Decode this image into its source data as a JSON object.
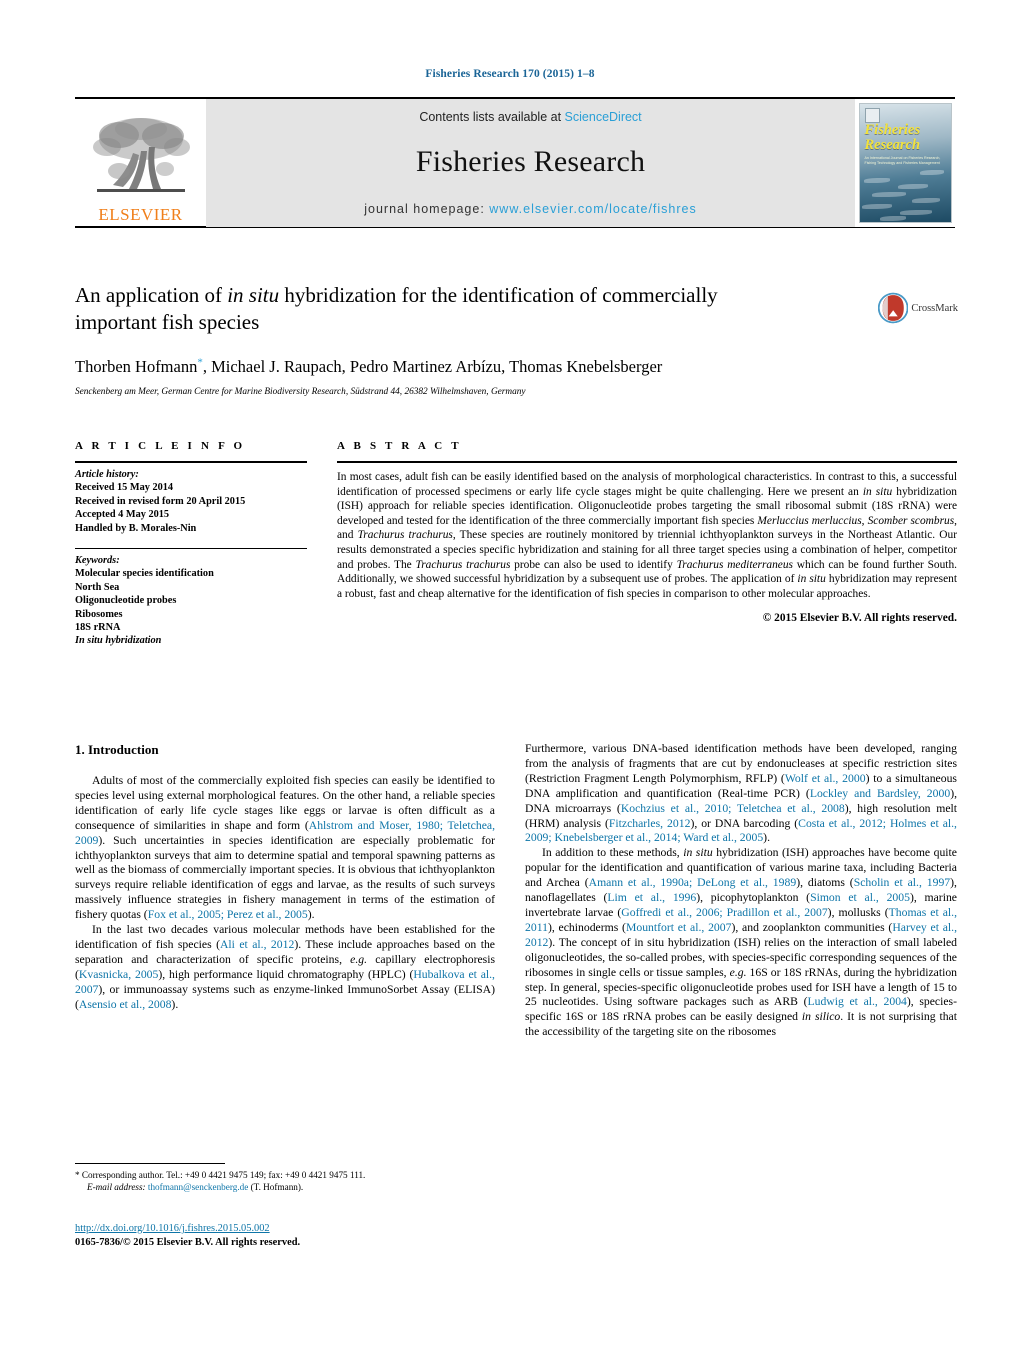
{
  "running_head": "Fisheries Research 170 (2015) 1–8",
  "masthead": {
    "publisher_logo_text": "ELSEVIER",
    "contents_prefix": "Contents lists available at",
    "contents_link": "ScienceDirect",
    "journal_name": "Fisheries Research",
    "homepage_prefix": "journal homepage:",
    "homepage_url": "www.elsevier.com/locate/fishres",
    "cover": {
      "title_line1": "Fisheries",
      "title_line2": "Research",
      "subtitle": "An International Journal on Fisheries Research, Fishing Technology and Fisheries Management"
    }
  },
  "article": {
    "title_part1": "An application of ",
    "title_italic": "in situ",
    "title_part2": " hybridization for the identification of commercially important fish species",
    "authors": "Thorben Hofmann, Michael J. Raupach, Pedro Martinez Arbízu, Thomas Knebelsberger",
    "author_marker": "*",
    "affiliation": "Senckenberg am Meer, German Centre for Marine Biodiversity Research, Südstrand 44, 26382 Wilhelmshaven, Germany",
    "crossmark_label": "CrossMark"
  },
  "article_info": {
    "heading": "A R T I C L E   I N F O",
    "history_label": "Article history:",
    "history": [
      "Received 15 May 2014",
      "Received in revised form 20 April 2015",
      "Accepted 4 May 2015",
      "Handled by B. Morales-Nin"
    ],
    "keywords_label": "Keywords:",
    "keywords": [
      "Molecular species identification",
      "North Sea",
      "Oligonucleotide probes",
      "Ribosomes",
      "18S rRNA"
    ],
    "keyword_italic": "In situ hybridization"
  },
  "abstract": {
    "heading": "A B S T R A C T",
    "paragraphs": [
      "In most cases, adult fish can be easily identified based on the analysis of morphological characteristics. In contrast to this, a successful identification of processed specimens or early life cycle stages might be quite challenging. Here we present an ",
      " hybridization (ISH) approach for reliable species identification. Oligonucleotide probes targeting the small ribosomal submit (18S rRNA) were developed and tested for the identification of the three commercially important fish species ",
      ", These species are routinely monitored by triennial ichthyoplankton surveys in the Northeast Atlantic. Our results demonstrated a species specific hybridization and staining for all three target species using a combination of helper, competitor and probes. The ",
      " probe can also be used to identify ",
      " which can be found further South. Additionally, we showed successful hybridization by a subsequent use of probes. The application of ",
      " hybridization may represent a robust, fast and cheap alternative for the identification of fish species in comparison to other molecular approaches."
    ],
    "species1": "Merluccius merluccius",
    "species2": "Scomber scombrus",
    "species3": "Trachurus trachurus",
    "species4": "Trachurus mediterraneus",
    "in_situ": "in situ",
    "copyright": "© 2015 Elsevier B.V. All rights reserved."
  },
  "intro": {
    "heading": "1.  Introduction",
    "p1_a": "Adults of most of the commercially exploited fish species can easily be identified to species level using external morphological features. On the other hand, a reliable species identification of early life cycle stages like eggs or larvae is often difficult as a consequence of similarities in shape and form (",
    "p1_ref1": "Ahlstrom and Moser, 1980; Teletchea, 2009",
    "p1_b": "). Such uncertainties in species identification are especially problematic for ichthyoplankton surveys that aim to determine spatial and temporal spawning patterns as well as the biomass of commercially important species. It is obvious that ichthyoplankton surveys require reliable identification of eggs and larvae, as the results of such surveys massively influence strategies in fishery management in terms of the estimation of fishery quotas (",
    "p1_ref2": "Fox et al., 2005; Perez et al., 2005",
    "p1_c": ").",
    "p2_a": "In the last two decades various molecular methods have been established for the identification of fish species (",
    "p2_ref1": "Ali et al., 2012",
    "p2_b": "). These include approaches based on the separation and characterization of specific proteins, ",
    "p2_eg1": "e.g.",
    "p2_c": " capillary electrophoresis (",
    "p2_ref2": "Kvasnicka, 2005",
    "p2_d": "), high performance liquid chromatography (HPLC) (",
    "p2_ref3": "Hubalkova et al., 2007",
    "p2_e": "), or immunoassay systems such as enzyme-linked ImmunoSorbet Assay (ELISA) (",
    "p2_ref4": "Asensio et al., 2008",
    "p2_f": ").",
    "p3_a": "Furthermore, various DNA-based identification methods have been developed, ranging from the analysis of fragments that are cut by endonucleases at specific restriction sites (Restriction Fragment Length Polymorphism, RFLP) (",
    "p3_ref1": "Wolf et al., 2000",
    "p3_b": ") to a simultaneous DNA amplification and quantification (Real-time PCR) (",
    "p3_ref2": "Lockley and Bardsley, 2000",
    "p3_c": "), DNA microarrays (",
    "p3_ref3": "Kochzius et al., 2010; Teletchea et al., 2008",
    "p3_d": "), high resolution melt (HRM) analysis (",
    "p3_ref4": "Fitzcharles, 2012",
    "p3_e": "), or DNA barcoding (",
    "p3_ref5": "Costa et al., 2012; Holmes et al., 2009; Knebelsberger et al., 2014; Ward et al., 2005",
    "p3_f": ").",
    "p4_a": "In addition to these methods, ",
    "p4_it1": "in situ",
    "p4_b": " hybridization (ISH) approaches have become quite popular for the identification and quantification of various marine taxa, including Bacteria and Archea (",
    "p4_ref1": "Amann et al., 1990a; DeLong et al., 1989",
    "p4_c": "), diatoms (",
    "p4_ref2": "Scholin et al., 1997",
    "p4_d": "), nanoflagellates (",
    "p4_ref3": "Lim et al., 1996",
    "p4_e": "), picophytoplankton (",
    "p4_ref4": "Simon et al., 2005",
    "p4_f": "), marine invertebrate larvae (",
    "p4_ref5": "Goffredi et al., 2006; Pradillon et al., 2007",
    "p4_g": "), mollusks (",
    "p4_ref6": "Thomas et al., 2011",
    "p4_h": "), echinoderms (",
    "p4_ref7": "Mountfort et al., 2007",
    "p4_i": "), and zooplankton communities (",
    "p4_ref8": "Harvey et al., 2012",
    "p4_j": "). The concept of in situ hybridization (ISH) relies on the interaction of small labeled oligonucleotides, the so-called probes, with species-specific corresponding sequences of the ribosomes in single cells or tissue samples, ",
    "p4_eg": "e.g.",
    "p4_k": " 16S or 18S rRNAs, during the hybridization step. In general, species-specific oligonucleotide probes used for ISH have a length of 15 to 25 nucleotides. Using software packages such as ARB (",
    "p4_ref9": "Ludwig et al., 2004",
    "p4_l": "), species-specific 16S or 18S rRNA probes can be easily designed ",
    "p4_it2": "in silico",
    "p4_m": ". It is not surprising that the accessibility of the targeting site on the ribosomes"
  },
  "footnote": {
    "marker": "*",
    "corresponding": " Corresponding author. Tel.: +49 0 4421 9475 149; fax: +49 0 4421 9475 111.",
    "email_label": "E-mail address:",
    "email": "thofmann@senckenberg.de",
    "email_suffix": " (T. Hofmann)."
  },
  "doi": {
    "url": "http://dx.doi.org/10.1016/j.fishres.2015.05.002",
    "issn_line": "0165-7836/© 2015 Elsevier B.V. All rights reserved."
  },
  "colors": {
    "link": "#0e75a8",
    "sciencedirect": "#2a9fd6",
    "elsevier_orange": "#F07F1A",
    "masthead_bg": "#e4e4e4"
  }
}
